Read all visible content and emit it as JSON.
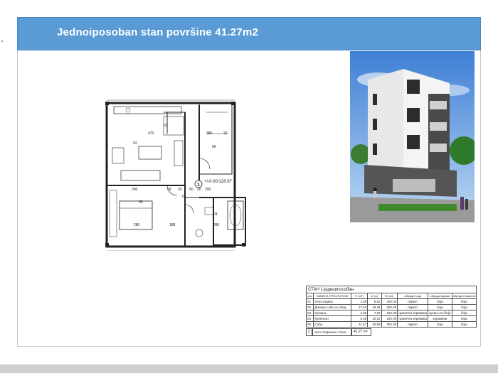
{
  "header": {
    "title": "Jednoiposoban stan površine 41.27m2"
  },
  "plan": {
    "rooms": [
      {
        "id": "01",
        "label": "01"
      },
      {
        "id": "02",
        "label": "02"
      },
      {
        "id": "03",
        "label": "03"
      },
      {
        "id": "04",
        "label": "04"
      },
      {
        "id": "05",
        "label": "05"
      },
      {
        "id": "06",
        "label": "06"
      }
    ],
    "dimensions": [
      "470",
      "290",
      "280",
      "380",
      "20",
      "188",
      "280",
      "50",
      "30",
      "20",
      "290",
      "28"
    ],
    "entry_marker": "1",
    "elevation": "+/-0.00/128.67"
  },
  "legend": {
    "title": "СТАН 1-једноипособан",
    "headers": [
      "озн.",
      "НАМЕНА ПРОСТОРИЈЕ",
      "П (m²)",
      "О (m)",
      "В (cm)",
      "обрада пода",
      "обрада зидова",
      "обрада плафона"
    ],
    "rows": [
      {
        "code": "01",
        "name": "Улаз-ходник",
        "area": "2.65",
        "perimeter": "6.52",
        "height": "262.00",
        "floor": "паркет",
        "walls": "боја",
        "ceiling": "боја"
      },
      {
        "code": "02",
        "name": "Дневна соба са обед.",
        "area": "17.53",
        "perimeter": "18.36",
        "height": "262.00",
        "floor": "паркет",
        "walls": "боја",
        "ceiling": "боја"
      },
      {
        "code": "03",
        "name": "Кухиња",
        "area": "3.06",
        "perimeter": "7.00",
        "height": "262.00",
        "floor": "гранитна керамика",
        "walls": "кухињ.пл./боја",
        "ceiling": "боја"
      },
      {
        "code": "04",
        "name": "Купатило",
        "area": "6.46",
        "perimeter": "10.18",
        "height": "262.00",
        "floor": "гранитна керамика",
        "walls": "керамика",
        "ceiling": "боја"
      },
      {
        "code": "05",
        "name": "Соба",
        "area": "11.57",
        "perimeter": "15.59",
        "height": "262.00",
        "floor": "паркет",
        "walls": "боја",
        "ceiling": "боја"
      }
    ],
    "total": {
      "symbol": "Σ",
      "label": "нето површина стана",
      "value": "41.27 m²"
    }
  }
}
